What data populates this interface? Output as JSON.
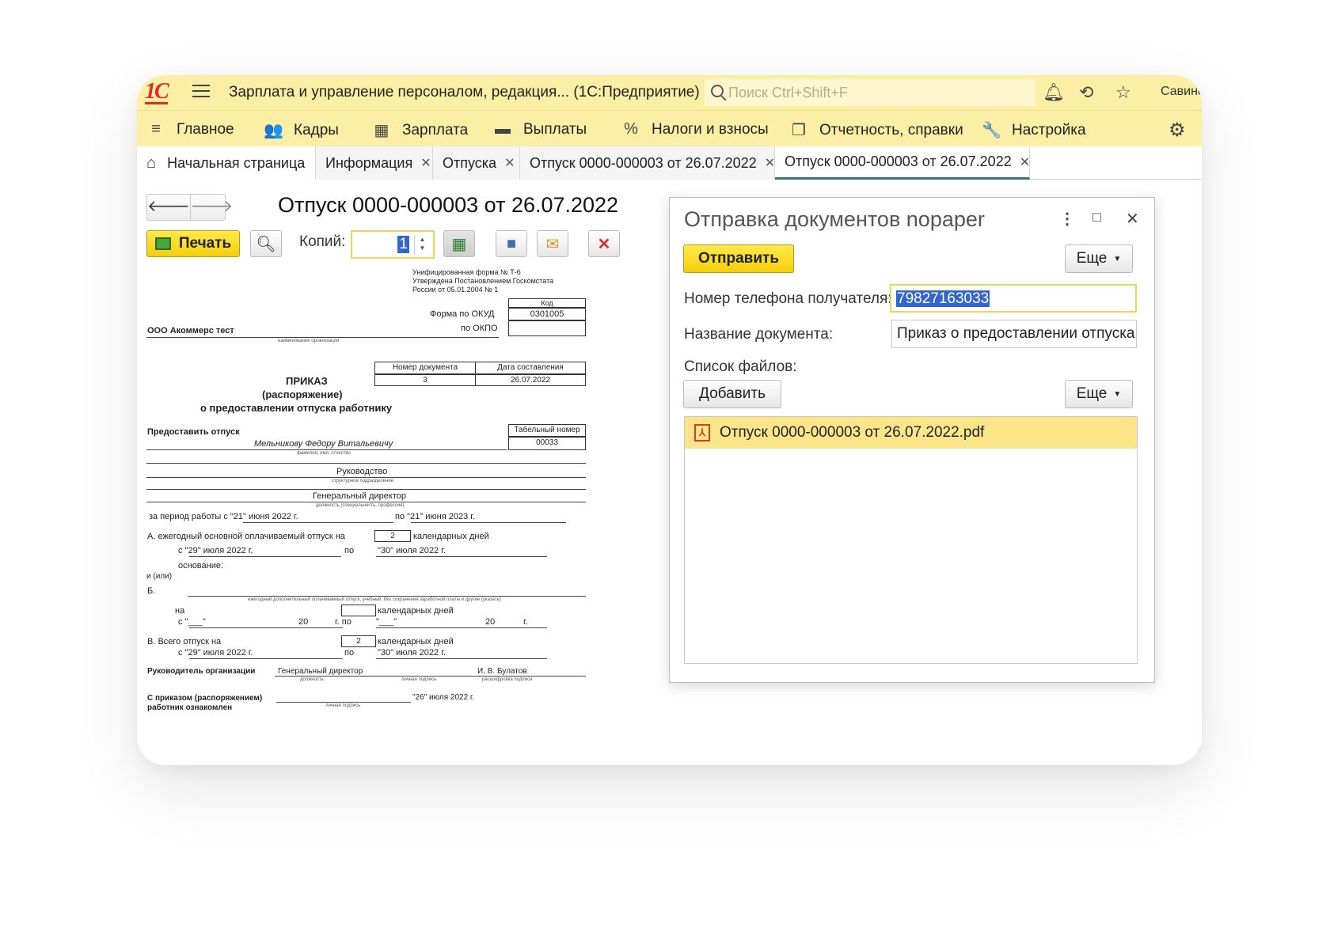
{
  "app": {
    "logo": "1С",
    "title": "Зарплата и управление персоналом, редакция... (1С:Предприятие)",
    "search_placeholder": "Поиск Ctrl+Shift+F",
    "user": "Савинс"
  },
  "menu": [
    {
      "label": "Главное",
      "icon": "≡"
    },
    {
      "label": "Кадры",
      "icon": "👥"
    },
    {
      "label": "Зарплата",
      "icon": "▦"
    },
    {
      "label": "Выплаты",
      "icon": "▬"
    },
    {
      "label": "Налоги и взносы",
      "icon": "%"
    },
    {
      "label": "Отчетность, справки",
      "icon": "❐"
    },
    {
      "label": "Настройка",
      "icon": "🔧"
    }
  ],
  "tabs": [
    {
      "label": "Начальная страница"
    },
    {
      "label": "Информация"
    },
    {
      "label": "Отпуска"
    },
    {
      "label": "Отпуск 0000-000003 от 26.07.2022"
    },
    {
      "label": "Отпуск 0000-000003 от 26.07.2022"
    }
  ],
  "doc": {
    "title": "Отпуск 0000-000003 от 26.07.2022",
    "print_label": "Печать",
    "copies_label": "Копий:",
    "copies_value": "1"
  },
  "sheet": {
    "header1": "Унифицированная форма № Т-6",
    "header2": "Утверждена Постановлением Госкомстата",
    "header3": "России от 05.01.2004 № 1",
    "kod": "Код",
    "okud_label": "Форма по ОКУД",
    "okud_value": "0301005",
    "okpo_label": "по ОКПО",
    "org": "ООО Акоммерс тест",
    "org_hint": "наименование организации",
    "docnum_h": "Номер документа",
    "date_h": "Дата составления",
    "docnum": "3",
    "date": "26.07.2022",
    "title1": "ПРИКАЗ",
    "title2": "(распоряжение)",
    "title3": "о предоставлении отпуска работнику",
    "grant": "Предоставить отпуск",
    "tab_h": "Табельный номер",
    "tab_num": "00033",
    "employee": "Мельникову Федору Витальевичу",
    "employee_hint": "фамилия, имя, отчество",
    "dept": "Руководство",
    "dept_hint": "структурное подразделение",
    "position": "Генеральный директор",
    "position_hint": "должность (специальность, профессия)",
    "period": "за период работы с  \"21\" июня 2022 г.",
    "period_to": "по  \"21\" июня 2023 г.",
    "a_label": "А. ежегодный основной оплачиваемый отпуск на",
    "a_days": "2",
    "cal_days": "календарных дней",
    "a_from": "с  \"29\" июля 2022 г.",
    "po": "по",
    "a_to": "\"30\" июля 2022 г.",
    "osnovanie": "основание:",
    "ili": "и (или)",
    "b_label": "Б.",
    "b_hint": "ежегодный дополнительный оплачиваемый отпуск, учебный, без сохранения заработной платы и другие (указать)",
    "na": "на",
    "b_from": "с  \"___\"",
    "b_20": "20",
    "b_g": "г. по",
    "b_to": "\"___\"",
    "b_20b": "20",
    "b_gb": "г.",
    "v_label": "В.   Всего отпуск на",
    "v_days": "2",
    "v_from": "с  \"29\" июля 2022 г.",
    "v_to": "\"30\" июля 2022 г.",
    "head": "Руководитель организации",
    "head_pos": "Генеральный директор",
    "head_name": "И. В. Булатов",
    "hint_dolzh": "должность",
    "hint_podp": "личная подпись",
    "hint_rasshifr": "расшифровка подписи",
    "acq1": "С приказом (распоряжением)",
    "acq2": "работник ознакомлен",
    "acq_date": "\"26\" июля 2022 г.",
    "acq_hint": "личная подпись"
  },
  "dialog": {
    "title": "Отправка документов nopaper",
    "send": "Отправить",
    "more": "Еще",
    "phone_label": "Номер телефона получателя:",
    "phone": "79827163033",
    "docname_label": "Название документа:",
    "docname": "Приказ о предоставлении отпуска",
    "files_label": "Список файлов:",
    "add": "Добавить",
    "more2": "Еще",
    "file": "Отпуск 0000-000003 от 26.07.2022.pdf"
  }
}
